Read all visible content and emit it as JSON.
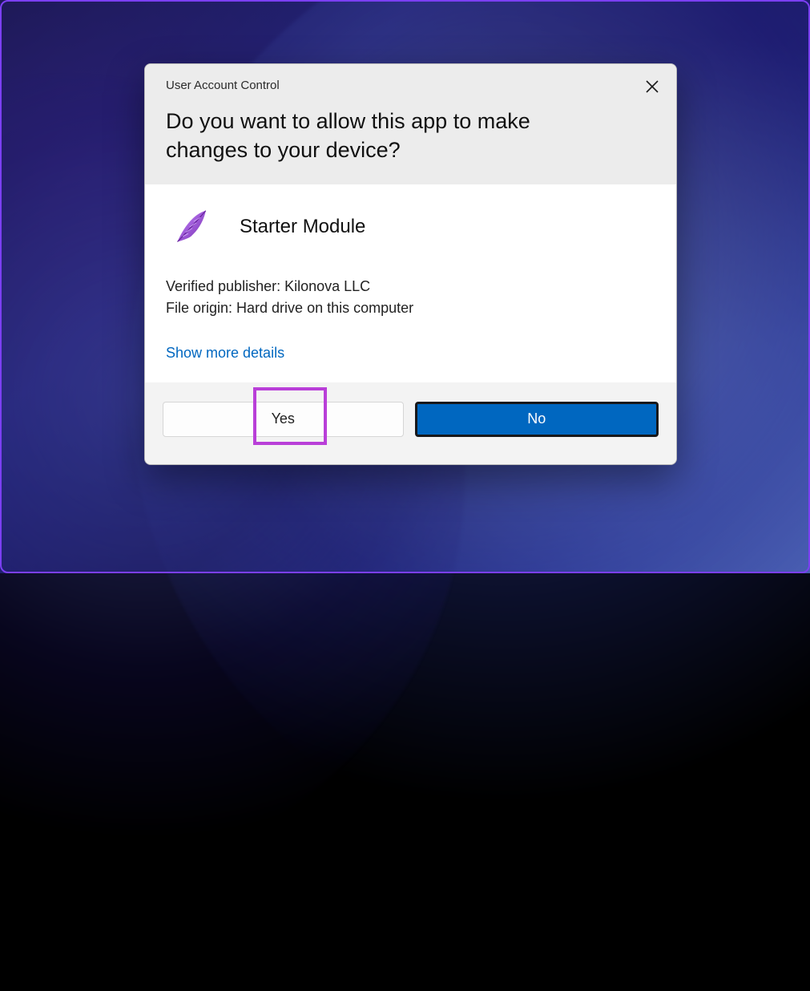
{
  "dialog": {
    "titleSmall": "User Account Control",
    "question": "Do you want to allow this app to make changes to your device?",
    "app": {
      "name": "Starter Module",
      "iconName": "feather-icon"
    },
    "publisherLine": "Verified publisher: Kilonova LLC",
    "originLine": "File origin: Hard drive on this computer",
    "detailsLink": "Show more details",
    "buttons": {
      "yes": "Yes",
      "no": "No"
    }
  }
}
